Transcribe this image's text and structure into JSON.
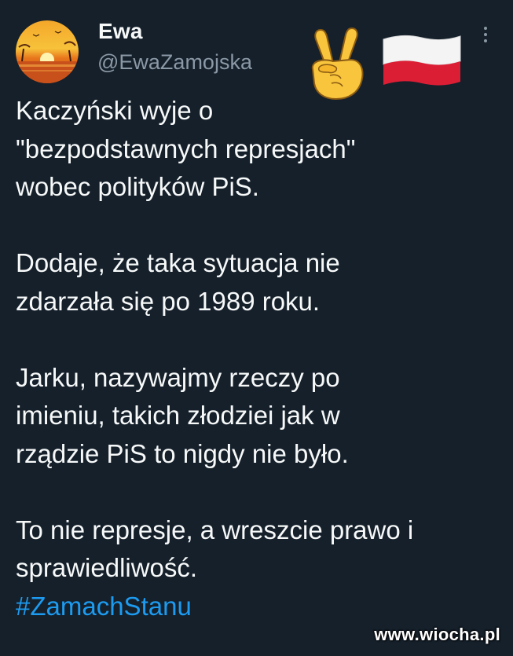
{
  "tweet": {
    "author": {
      "name": "Ewa",
      "handle": "@EwaZamojska",
      "avatar_icon": "sunset-avatar"
    },
    "header_emojis": [
      "victory-hand-icon",
      "poland-flag-icon"
    ],
    "more_icon": "more-vertical-icon",
    "paragraphs": [
      "Kaczyński wyje o\n\"bezpodstawnych represjach\"\nwobec polityków PiS.",
      "Dodaje, że taka sytuacja nie\nzdarzała się po 1989 roku.",
      "Jarku, nazywajmy rzeczy po\nimieniu, takich złodziei jak w\nrządzie PiS to nigdy nie było.",
      "To nie represje, a wreszcie prawo i\nsprawiedliwość."
    ],
    "hashtag": "#ZamachStanu"
  },
  "watermark": "www.wiocha.pl",
  "colors": {
    "background": "#15202b",
    "text": "#f7f9f9",
    "handle": "#8b98a5",
    "hashtag": "#1d9bf0"
  }
}
